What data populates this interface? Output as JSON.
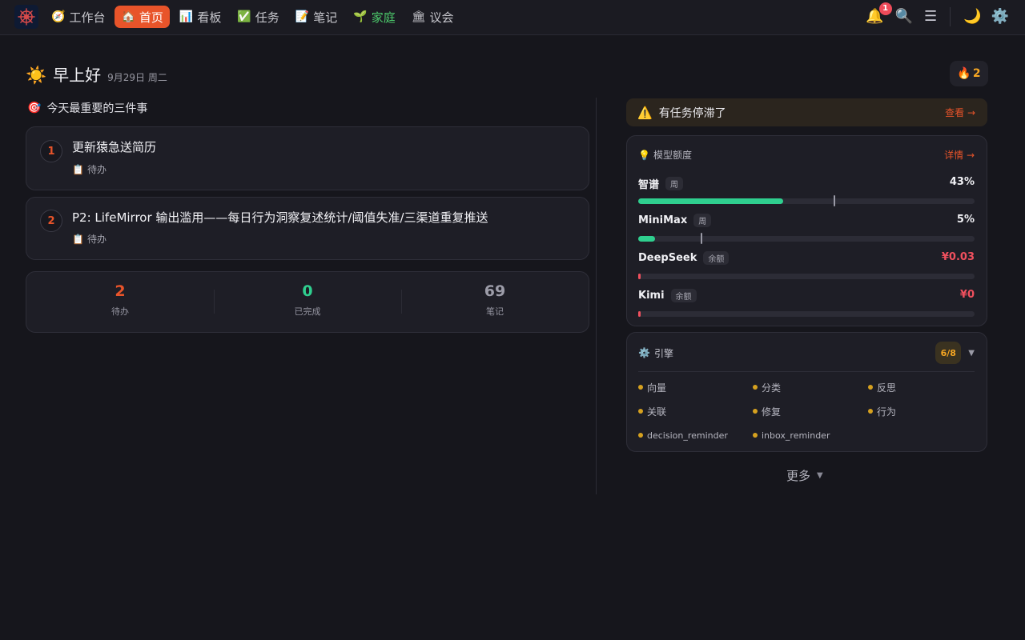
{
  "nav": {
    "logo_icon": "ship-wheel-icon",
    "items": [
      {
        "icon": "🧭",
        "label": "工作台"
      },
      {
        "icon": "🏠",
        "label": "首页"
      },
      {
        "icon": "📊",
        "label": "看板"
      },
      {
        "icon": "✅",
        "label": "任务"
      },
      {
        "icon": "📝",
        "label": "笔记"
      },
      {
        "icon": "🌱",
        "label": "家庭"
      },
      {
        "icon": "🏛",
        "label": "议会"
      }
    ],
    "active_index": 1,
    "notifications_count": "1",
    "icons": {
      "bell": "🔔",
      "search": "🔍",
      "menu": "☰",
      "moon": "🌙",
      "gear": "⚙️"
    },
    "accent_color": "#e8542a"
  },
  "greeting": {
    "icon": "☀️",
    "text": "早上好",
    "date": "9月29日 周二"
  },
  "streak": {
    "icon": "🔥",
    "value": "2"
  },
  "top_three": {
    "icon": "🎯",
    "title": "今天最重要的三件事",
    "tasks": [
      {
        "num": "1",
        "title": "更新猿急送简历",
        "status_icon": "📋",
        "status": "待办"
      },
      {
        "num": "2",
        "title": "P2: LifeMirror 输出滥用——每日行为洞察复述统计/阈值失准/三渠道重复推送",
        "status_icon": "📋",
        "status": "待办"
      }
    ]
  },
  "stats": [
    {
      "value": "2",
      "label": "待办",
      "color": "#e8542a"
    },
    {
      "value": "0",
      "label": "已完成",
      "color": "#2fcf8f"
    },
    {
      "value": "69",
      "label": "笔记",
      "color": "#9c9ca8"
    }
  ],
  "alert": {
    "icon": "⚠️",
    "text": "有任务停滞了",
    "link": "查看 →"
  },
  "quota": {
    "icon": "💡",
    "title": "模型额度",
    "link": "详情 →",
    "rows": [
      {
        "name": "智谱",
        "tag": "周",
        "value": "43%",
        "fill": 0.43,
        "marker": 0.58,
        "warn": false
      },
      {
        "name": "MiniMax",
        "tag": "周",
        "value": "5%",
        "fill": 0.05,
        "marker": 0.185,
        "warn": false
      },
      {
        "name": "DeepSeek",
        "tag": "余额",
        "value": "¥0.03",
        "fill": 0.006,
        "marker": null,
        "warn": true
      },
      {
        "name": "Kimi",
        "tag": "余额",
        "value": "¥0",
        "fill": 0.006,
        "marker": null,
        "warn": true
      }
    ]
  },
  "engine": {
    "icon": "⚙️",
    "title": "引擎",
    "count": "6/8",
    "caret": "▼",
    "items": [
      "向量",
      "分类",
      "反思",
      "关联",
      "修复",
      "行为",
      "decision_reminder",
      "inbox_reminder"
    ]
  },
  "more": {
    "label": "更多",
    "caret": "▼"
  }
}
